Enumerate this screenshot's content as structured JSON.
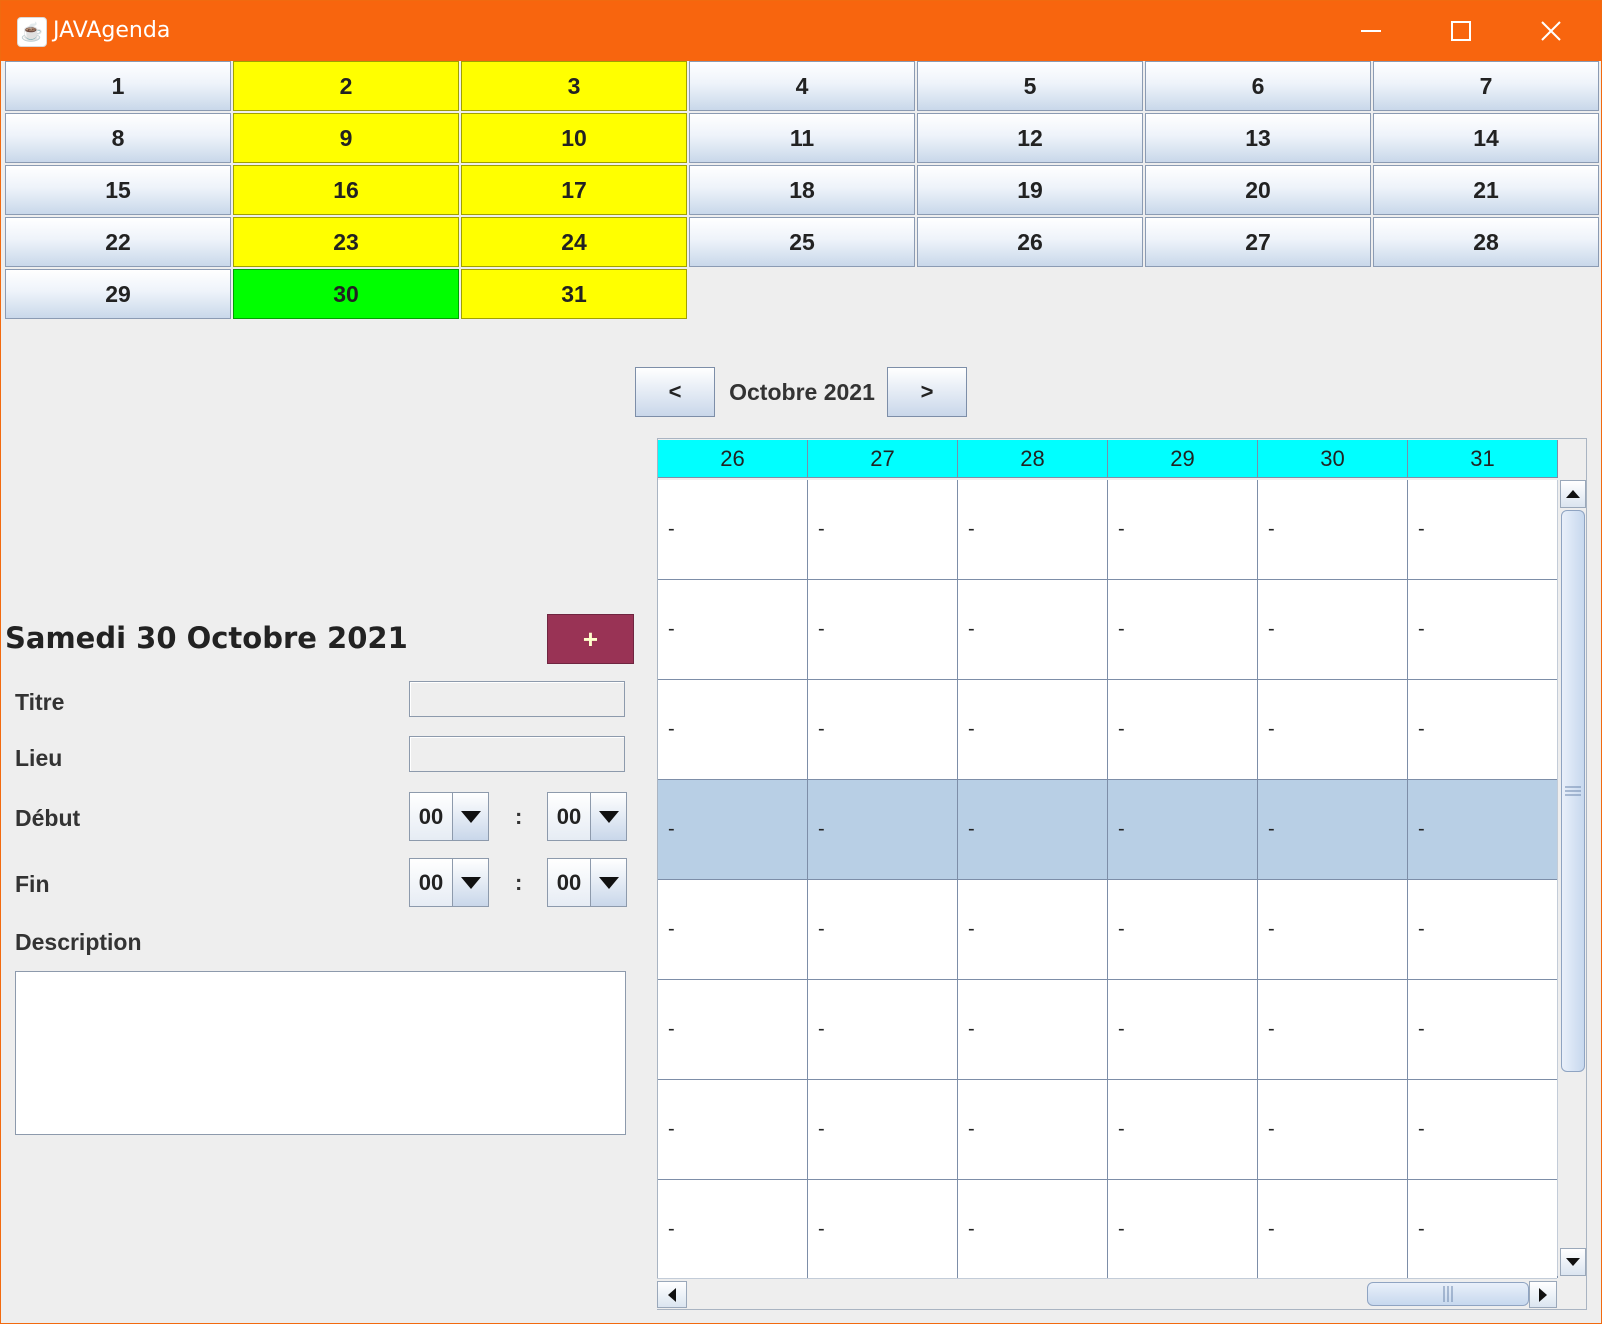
{
  "window": {
    "title": "JAVAgenda"
  },
  "month_days": {
    "days": [
      "1",
      "2",
      "3",
      "4",
      "5",
      "6",
      "7",
      "8",
      "9",
      "10",
      "11",
      "12",
      "13",
      "14",
      "15",
      "16",
      "17",
      "18",
      "19",
      "20",
      "21",
      "22",
      "23",
      "24",
      "25",
      "26",
      "27",
      "28",
      "29",
      "30",
      "31"
    ],
    "highlighted_days": [
      "2",
      "3",
      "9",
      "10",
      "16",
      "17",
      "23",
      "24",
      "31"
    ],
    "selected_day": "30",
    "colors": {
      "default": "#dce6f2",
      "highlight": "#ffff00",
      "selected": "#00ff00"
    }
  },
  "navigation": {
    "prev_label": "<",
    "next_label": ">",
    "month_label": "Octobre 2021"
  },
  "event_form": {
    "date_title": "Samedi 30 Octobre 2021",
    "add_button_label": "+",
    "title_label": "Titre",
    "title_value": "",
    "place_label": "Lieu",
    "place_value": "",
    "start_label": "Début",
    "start_hour": "00",
    "start_minute": "00",
    "end_label": "Fin",
    "end_hour": "00",
    "end_minute": "00",
    "time_separator": ":",
    "description_label": "Description",
    "description_value": ""
  },
  "week_table": {
    "columns": [
      "26",
      "27",
      "28",
      "29",
      "30",
      "31"
    ],
    "rows": [
      [
        "-",
        "-",
        "-",
        "-",
        "-",
        "-"
      ],
      [
        "-",
        "-",
        "-",
        "-",
        "-",
        "-"
      ],
      [
        "-",
        "-",
        "-",
        "-",
        "-",
        "-"
      ],
      [
        "-",
        "-",
        "-",
        "-",
        "-",
        "-"
      ],
      [
        "-",
        "-",
        "-",
        "-",
        "-",
        "-"
      ],
      [
        "-",
        "-",
        "-",
        "-",
        "-",
        "-"
      ],
      [
        "-",
        "-",
        "-",
        "-",
        "-",
        "-"
      ],
      [
        "-",
        "-",
        "-",
        "-",
        "-",
        "-"
      ]
    ],
    "selected_row": 3,
    "header_color": "#00ffff",
    "selection_color": "#b8cfe5"
  },
  "scrollbars": {
    "vertical_thumb_icon": "grip-lines-icon",
    "horizontal_thumb_icon": "grip-lines-icon"
  }
}
